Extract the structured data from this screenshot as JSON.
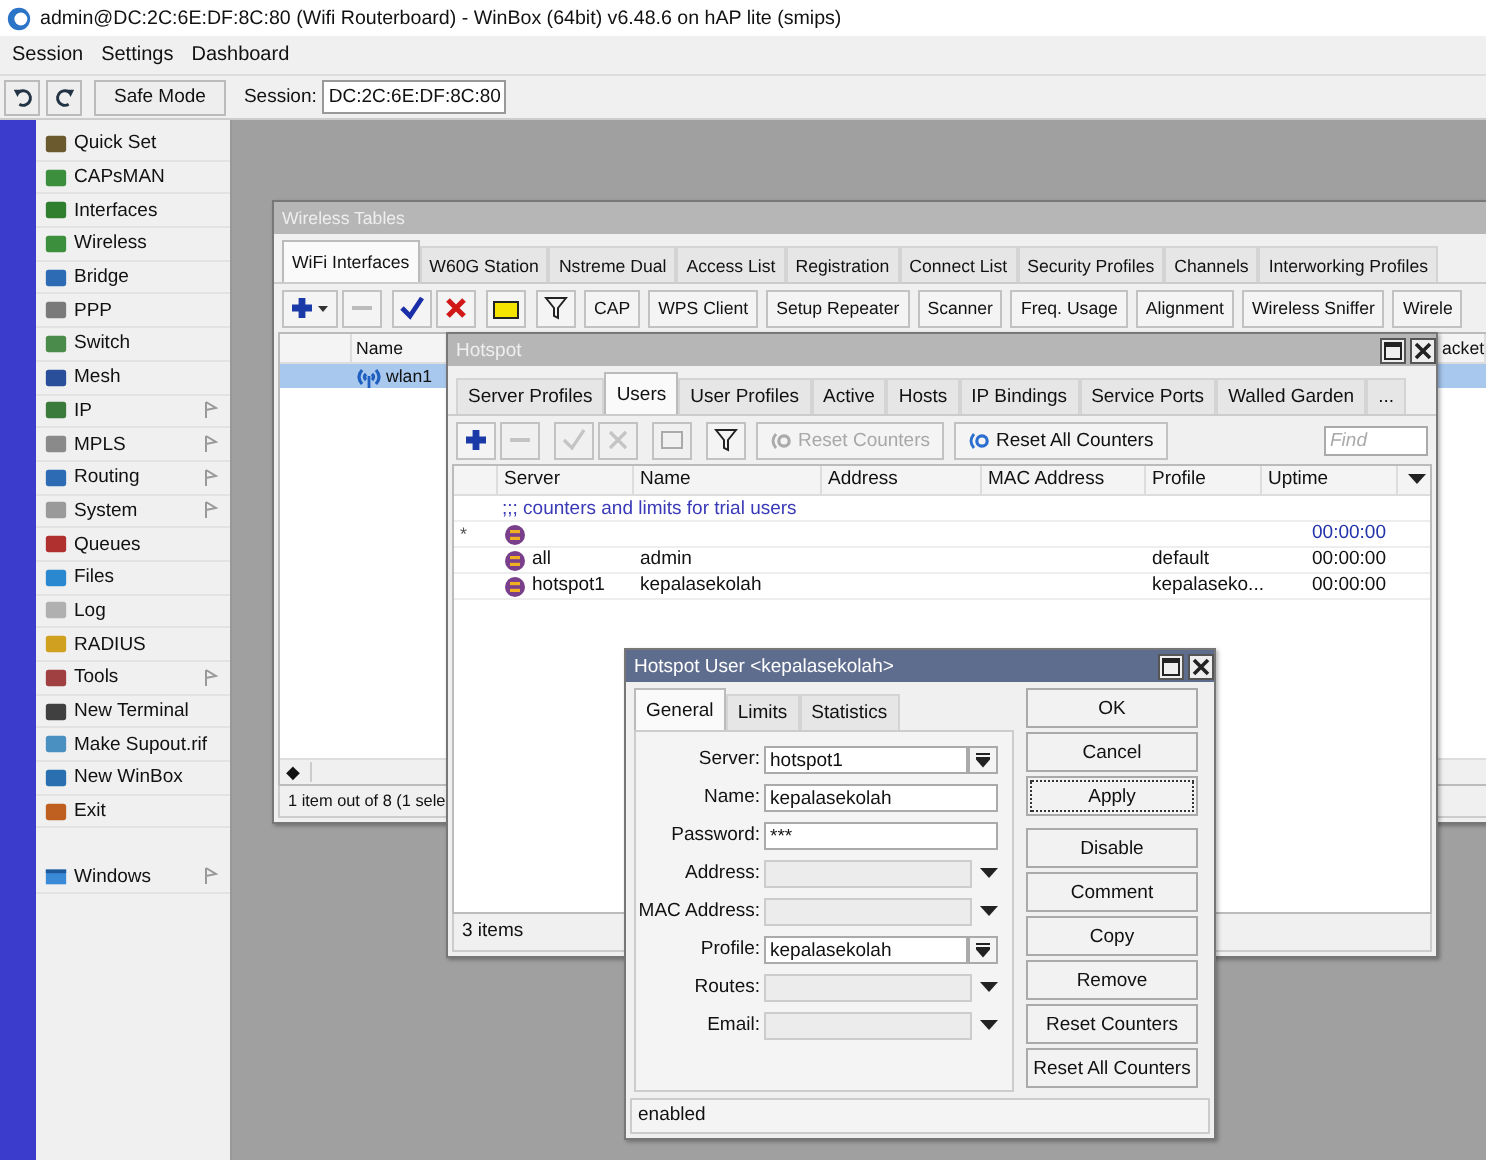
{
  "window": {
    "title": "admin@DC:2C:6E:DF:8C:80 (Wifi Routerboard) - WinBox (64bit) v6.48.6 on hAP lite (smips)"
  },
  "menu": [
    "Session",
    "Settings",
    "Dashboard"
  ],
  "toolbar": {
    "safe_mode": "Safe Mode",
    "session_label": "Session:",
    "session_value": "DC:2C:6E:DF:8C:80"
  },
  "sidebar": {
    "items": [
      {
        "label": "Quick Set",
        "submenu": false
      },
      {
        "label": "CAPsMAN",
        "submenu": false
      },
      {
        "label": "Interfaces",
        "submenu": false
      },
      {
        "label": "Wireless",
        "submenu": false
      },
      {
        "label": "Bridge",
        "submenu": false
      },
      {
        "label": "PPP",
        "submenu": false
      },
      {
        "label": "Switch",
        "submenu": false
      },
      {
        "label": "Mesh",
        "submenu": false
      },
      {
        "label": "IP",
        "submenu": true
      },
      {
        "label": "MPLS",
        "submenu": true
      },
      {
        "label": "Routing",
        "submenu": true
      },
      {
        "label": "System",
        "submenu": true
      },
      {
        "label": "Queues",
        "submenu": false
      },
      {
        "label": "Files",
        "submenu": false
      },
      {
        "label": "Log",
        "submenu": false
      },
      {
        "label": "RADIUS",
        "submenu": false
      },
      {
        "label": "Tools",
        "submenu": true
      },
      {
        "label": "New Terminal",
        "submenu": false
      },
      {
        "label": "Make Supout.rif",
        "submenu": false
      },
      {
        "label": "New WinBox",
        "submenu": false
      },
      {
        "label": "Exit",
        "submenu": false
      }
    ],
    "bottom_items": [
      {
        "label": "Windows",
        "submenu": true
      }
    ]
  },
  "wireless_tables": {
    "title": "Wireless Tables",
    "active": false,
    "tabs": [
      {
        "label": "WiFi Interfaces",
        "selected": true
      },
      {
        "label": "W60G Station",
        "selected": false
      },
      {
        "label": "Nstreme Dual",
        "selected": false
      },
      {
        "label": "Access List",
        "selected": false
      },
      {
        "label": "Registration",
        "selected": false
      },
      {
        "label": "Connect List",
        "selected": false
      },
      {
        "label": "Security Profiles",
        "selected": false
      },
      {
        "label": "Channels",
        "selected": false
      },
      {
        "label": "Interworking Profiles",
        "selected": false
      }
    ],
    "buttons": [
      "CAP",
      "WPS Client",
      "Setup Repeater",
      "Scanner",
      "Freq. Usage",
      "Alignment",
      "Wireless Sniffer",
      "Wirele"
    ],
    "columns": [
      "Name",
      "acket"
    ],
    "rows": [
      {
        "name": "wlan1",
        "selected": true
      }
    ],
    "scroll_mark": "◆",
    "status": "1 item out of 8 (1 sele"
  },
  "hotspot": {
    "title": "Hotspot",
    "active": false,
    "tabs": [
      {
        "label": "Server Profiles",
        "selected": false
      },
      {
        "label": "Users",
        "selected": true
      },
      {
        "label": "User Profiles",
        "selected": false
      },
      {
        "label": "Active",
        "selected": false
      },
      {
        "label": "Hosts",
        "selected": false
      },
      {
        "label": "IP Bindings",
        "selected": false
      },
      {
        "label": "Service Ports",
        "selected": false
      },
      {
        "label": "Walled Garden",
        "selected": false
      },
      {
        "label": "...",
        "selected": false
      }
    ],
    "tools": [
      {
        "kind": "add",
        "disabled": false
      },
      {
        "kind": "remove",
        "disabled": true
      },
      {
        "kind": "enable",
        "disabled": true
      },
      {
        "kind": "disable",
        "disabled": true
      },
      {
        "kind": "comment",
        "disabled": true
      },
      {
        "kind": "filter",
        "disabled": false
      }
    ],
    "buttons": [
      {
        "label": "Reset Counters",
        "disabled": true
      },
      {
        "label": "Reset All Counters",
        "disabled": false
      }
    ],
    "find": {
      "placeholder": "Find"
    },
    "columns": [
      "Server",
      "Name",
      "Address",
      "MAC Address",
      "Profile",
      "Uptime"
    ],
    "rows": [
      {
        "kind": "trial",
        "comment": ";;; counters and limits for trial users",
        "flag": "*",
        "uptime": "00:00:00"
      },
      {
        "kind": "user",
        "server": "all",
        "name": "admin",
        "profile": "default",
        "uptime": "00:00:00"
      },
      {
        "kind": "user",
        "server": "hotspot1",
        "name": "kepalasekolah",
        "profile": "kepalaseko...",
        "uptime": "00:00:00"
      }
    ],
    "status": "3 items"
  },
  "user_dialog": {
    "title": "Hotspot User <kepalasekolah>",
    "active": true,
    "tabs": [
      {
        "label": "General",
        "selected": true
      },
      {
        "label": "Limits",
        "selected": false
      },
      {
        "label": "Statistics",
        "selected": false
      }
    ],
    "fields": [
      {
        "label": "Server:",
        "kind": "select",
        "value": "hotspot1"
      },
      {
        "label": "Name:",
        "kind": "text",
        "value": "kepalasekolah"
      },
      {
        "label": "Password:",
        "kind": "text",
        "value": "***"
      },
      {
        "label": "Address:",
        "kind": "combo"
      },
      {
        "label": "MAC Address:",
        "kind": "combo"
      },
      {
        "label": "Profile:",
        "kind": "select",
        "value": "kepalasekolah"
      },
      {
        "label": "Routes:",
        "kind": "combo"
      },
      {
        "label": "Email:",
        "kind": "combo"
      }
    ],
    "buttons": [
      {
        "label": "OK",
        "focused": false
      },
      {
        "label": "Cancel",
        "focused": false
      },
      {
        "label": "Apply",
        "focused": true
      },
      {
        "label": "Disable",
        "focused": false
      },
      {
        "label": "Comment",
        "focused": false
      },
      {
        "label": "Copy",
        "focused": false
      },
      {
        "label": "Remove",
        "focused": false
      },
      {
        "label": "Reset Counters",
        "focused": false
      },
      {
        "label": "Reset All Counters",
        "focused": false
      }
    ],
    "status": "enabled"
  }
}
